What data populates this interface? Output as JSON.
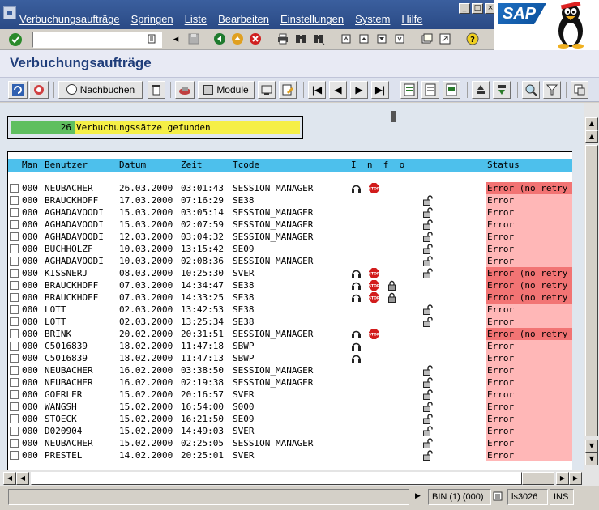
{
  "menu": [
    "Verbuchungsaufträge",
    "Springen",
    "Liste",
    "Bearbeiten",
    "Einstellungen",
    "System",
    "Hilfe"
  ],
  "logo": {
    "text": "SAP"
  },
  "title": "Verbuchungsaufträge",
  "toolbar": {
    "nachbuchen": "Nachbuchen",
    "module": "Module"
  },
  "message": {
    "count": "26",
    "text": "Verbuchungssätze gefunden"
  },
  "columns": {
    "man": "Man",
    "benutzer": "Benutzer",
    "datum": "Datum",
    "zeit": "Zeit",
    "tcode": "Tcode",
    "info": "I  n  f  o",
    "status": "Status"
  },
  "rows": [
    {
      "man": "000",
      "user": "NEUBACHER",
      "date": "26.03.2000",
      "time": "03:01:43",
      "tcode": "SESSION_MANAGER",
      "icons": [
        "headset",
        "stop"
      ],
      "status": "Error (no retry",
      "st": "nr"
    },
    {
      "man": "000",
      "user": "BRAUCKHOFF",
      "date": "17.03.2000",
      "time": "07:16:29",
      "tcode": "SE38",
      "icons": [
        "open-lock"
      ],
      "status": "Error",
      "st": "err"
    },
    {
      "man": "000",
      "user": "AGHADAVOODI",
      "date": "15.03.2000",
      "time": "03:05:14",
      "tcode": "SESSION_MANAGER",
      "icons": [
        "open-lock"
      ],
      "status": "Error",
      "st": "err"
    },
    {
      "man": "000",
      "user": "AGHADAVOODI",
      "date": "15.03.2000",
      "time": "02:07:59",
      "tcode": "SESSION_MANAGER",
      "icons": [
        "open-lock"
      ],
      "status": "Error",
      "st": "err"
    },
    {
      "man": "000",
      "user": "AGHADAVOODI",
      "date": "12.03.2000",
      "time": "03:04:32",
      "tcode": "SESSION_MANAGER",
      "icons": [
        "open-lock"
      ],
      "status": "Error",
      "st": "err"
    },
    {
      "man": "000",
      "user": "BUCHHOLZF",
      "date": "10.03.2000",
      "time": "13:15:42",
      "tcode": "SE09",
      "icons": [
        "open-lock"
      ],
      "status": "Error",
      "st": "err"
    },
    {
      "man": "000",
      "user": "AGHADAVOODI",
      "date": "10.03.2000",
      "time": "02:08:36",
      "tcode": "SESSION_MANAGER",
      "icons": [
        "open-lock"
      ],
      "status": "Error",
      "st": "err"
    },
    {
      "man": "000",
      "user": "KISSNERJ",
      "date": "08.03.2000",
      "time": "10:25:30",
      "tcode": "SVER",
      "icons": [
        "headset",
        "stop",
        "open-lock"
      ],
      "status": "Error (no retry",
      "st": "nr"
    },
    {
      "man": "000",
      "user": "BRAUCKHOFF",
      "date": "07.03.2000",
      "time": "14:34:47",
      "tcode": "SE38",
      "icons": [
        "headset",
        "stop",
        "closed-lock"
      ],
      "status": "Error (no retry",
      "st": "nr"
    },
    {
      "man": "000",
      "user": "BRAUCKHOFF",
      "date": "07.03.2000",
      "time": "14:33:25",
      "tcode": "SE38",
      "icons": [
        "headset",
        "stop",
        "closed-lock"
      ],
      "status": "Error (no retry",
      "st": "nr"
    },
    {
      "man": "000",
      "user": "LOTT",
      "date": "02.03.2000",
      "time": "13:42:53",
      "tcode": "SE38",
      "icons": [
        "open-lock"
      ],
      "status": "Error",
      "st": "err"
    },
    {
      "man": "000",
      "user": "LOTT",
      "date": "02.03.2000",
      "time": "13:25:34",
      "tcode": "SE38",
      "icons": [
        "open-lock"
      ],
      "status": "Error",
      "st": "err"
    },
    {
      "man": "000",
      "user": "BRINK",
      "date": "20.02.2000",
      "time": "20:31:51",
      "tcode": "SESSION_MANAGER",
      "icons": [
        "headset",
        "stop"
      ],
      "status": "Error (no retry",
      "st": "nr"
    },
    {
      "man": "000",
      "user": "C5016839",
      "date": "18.02.2000",
      "time": "11:47:18",
      "tcode": "SBWP",
      "icons": [
        "headset"
      ],
      "status": "Error",
      "st": "err"
    },
    {
      "man": "000",
      "user": "C5016839",
      "date": "18.02.2000",
      "time": "11:47:13",
      "tcode": "SBWP",
      "icons": [
        "headset"
      ],
      "status": "Error",
      "st": "err"
    },
    {
      "man": "000",
      "user": "NEUBACHER",
      "date": "16.02.2000",
      "time": "03:38:50",
      "tcode": "SESSION_MANAGER",
      "icons": [
        "open-lock"
      ],
      "status": "Error",
      "st": "err"
    },
    {
      "man": "000",
      "user": "NEUBACHER",
      "date": "16.02.2000",
      "time": "02:19:38",
      "tcode": "SESSION_MANAGER",
      "icons": [
        "open-lock"
      ],
      "status": "Error",
      "st": "err"
    },
    {
      "man": "000",
      "user": "GOERLER",
      "date": "15.02.2000",
      "time": "20:16:57",
      "tcode": "SVER",
      "icons": [
        "open-lock"
      ],
      "status": "Error",
      "st": "err"
    },
    {
      "man": "000",
      "user": "WANGSH",
      "date": "15.02.2000",
      "time": "16:54:00",
      "tcode": "S000",
      "icons": [
        "open-lock"
      ],
      "status": "Error",
      "st": "err"
    },
    {
      "man": "000",
      "user": "STOECK",
      "date": "15.02.2000",
      "time": "16:21:50",
      "tcode": "SE09",
      "icons": [
        "open-lock"
      ],
      "status": "Error",
      "st": "err"
    },
    {
      "man": "000",
      "user": "D020904",
      "date": "15.02.2000",
      "time": "14:49:03",
      "tcode": "SVER",
      "icons": [
        "open-lock"
      ],
      "status": "Error",
      "st": "err"
    },
    {
      "man": "000",
      "user": "NEUBACHER",
      "date": "15.02.2000",
      "time": "02:25:05",
      "tcode": "SESSION_MANAGER",
      "icons": [
        "open-lock"
      ],
      "status": "Error",
      "st": "err"
    },
    {
      "man": "000",
      "user": "PRESTEL",
      "date": "14.02.2000",
      "time": "20:25:01",
      "tcode": "SVER",
      "icons": [
        "open-lock"
      ],
      "status": "Error",
      "st": "err"
    }
  ],
  "statusbar": {
    "system": "BIN (1) (000)",
    "server": "ls3026",
    "mode": "INS"
  }
}
